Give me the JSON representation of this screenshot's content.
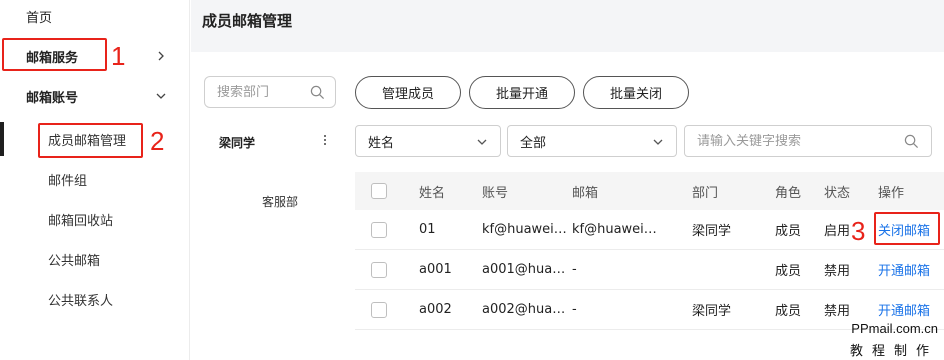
{
  "sidebar": {
    "items": [
      {
        "label": "首页"
      },
      {
        "label": "邮箱服务"
      },
      {
        "label": "邮箱账号"
      },
      {
        "label": "成员邮箱管理"
      },
      {
        "label": "邮件组"
      },
      {
        "label": "邮箱回收站"
      },
      {
        "label": "公共邮箱"
      },
      {
        "label": "公共联系人"
      }
    ]
  },
  "header": {
    "title": "成员邮箱管理"
  },
  "org": {
    "search_placeholder": "搜索部门",
    "root": "梁同学",
    "child": "客服部"
  },
  "toolbar": {
    "manage": "管理成员",
    "bulk_open": "批量开通",
    "bulk_close": "批量关闭"
  },
  "filters": {
    "field": "姓名",
    "status": "全部",
    "keyword_placeholder": "请输入关键字搜索"
  },
  "table": {
    "headers": {
      "name": "姓名",
      "account": "账号",
      "mailbox": "邮箱",
      "dept": "部门",
      "role": "角色",
      "status": "状态",
      "action": "操作"
    },
    "rows": [
      {
        "name": "01",
        "account": "kf@huawei…",
        "mailbox": "kf@huawei…",
        "dept": "梁同学",
        "role": "成员",
        "status": "启用",
        "action": "关闭邮箱"
      },
      {
        "name": "a001",
        "account": "a001@hua…",
        "mailbox": "-",
        "dept": "",
        "role": "成员",
        "status": "禁用",
        "action": "开通邮箱"
      },
      {
        "name": "a002",
        "account": "a002@hua…",
        "mailbox": "-",
        "dept": "梁同学",
        "role": "成员",
        "status": "禁用",
        "action": "开通邮箱"
      }
    ]
  },
  "annotations": {
    "n1": "1",
    "n2": "2",
    "n3": "3",
    "color": "#e8231a"
  },
  "watermark": {
    "line1": "PPmail.com.cn",
    "line2": "教程制作"
  },
  "colors": {
    "link": "#1a73e8",
    "annotation": "#e8231a"
  }
}
